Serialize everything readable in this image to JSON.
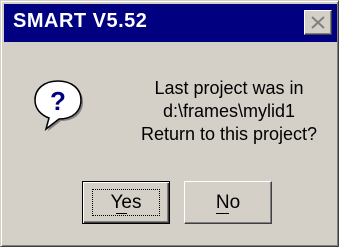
{
  "window": {
    "title": "SMART V5.52"
  },
  "icon": {
    "name": "question-icon",
    "glyph": "?",
    "color": "#000080"
  },
  "message": {
    "lines": [
      "Last project was in",
      "d:\\frames\\mylid1",
      "Return to this project?"
    ]
  },
  "buttons": {
    "yes_label": "Yes",
    "no_label": "No"
  },
  "colors": {
    "titlebar": "#000080",
    "face": "#d4d0c8"
  }
}
